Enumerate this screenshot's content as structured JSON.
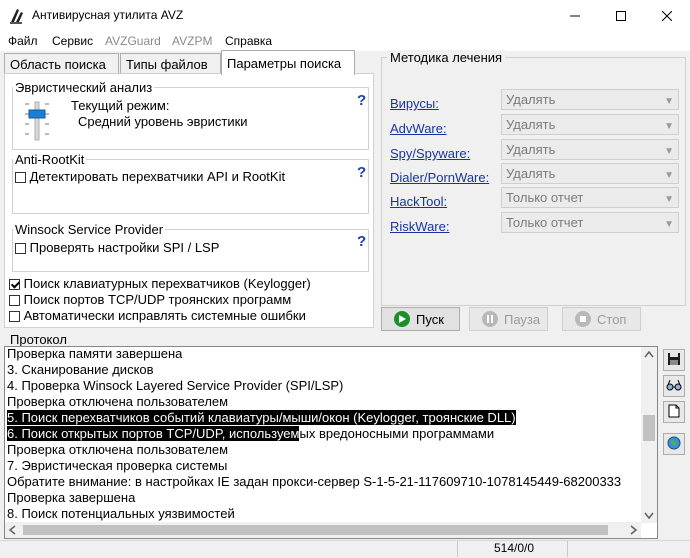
{
  "window": {
    "title": "Антивирусная утилита AVZ",
    "controls": [
      "minimize-icon",
      "maximize-icon",
      "close-icon"
    ]
  },
  "menu": {
    "items": [
      {
        "label": "Файл",
        "enabled": true
      },
      {
        "label": "Сервис",
        "enabled": true
      },
      {
        "label": "AVZGuard",
        "enabled": false
      },
      {
        "label": "AVZPM",
        "enabled": false
      },
      {
        "label": "Справка",
        "enabled": true
      }
    ]
  },
  "tabs": [
    {
      "label": "Область поиска",
      "active": false
    },
    {
      "label": "Типы файлов",
      "active": false
    },
    {
      "label": "Параметры поиска",
      "active": true
    }
  ],
  "search_params": {
    "heuristic": {
      "title": "Эвристический анализ",
      "mode_label": "Текущий режим:",
      "mode_value": "Средний уровень эвристики",
      "help": "?"
    },
    "antirootkit": {
      "title": "Anti-RootKit",
      "checkbox_label": "Детектировать перехватчики API и RootKit",
      "checked": false,
      "help": "?"
    },
    "winsock": {
      "title": "Winsock  Service Provider",
      "checkbox_label": "Проверять настройки SPI / LSP",
      "checked": false,
      "help": "?"
    },
    "options": [
      {
        "label": "Поиск клавиатурных перехватчиков (Keylogger)",
        "checked": true
      },
      {
        "label": "Поиск портов TCP/UDP троянских программ",
        "checked": false
      },
      {
        "label": "Автоматически исправлять системные ошибки",
        "checked": false
      }
    ]
  },
  "treatment": {
    "title": "Методика лечения",
    "rows": [
      {
        "label": "Вирусы:",
        "value": "Удалять"
      },
      {
        "label": "AdvWare:",
        "value": "Удалять"
      },
      {
        "label": "Spy/Spyware:",
        "value": "Удалять"
      },
      {
        "label": "Dialer/PornWare:",
        "value": "Удалять"
      },
      {
        "label": "HackTool:",
        "value": "Только отчет"
      },
      {
        "label": "RiskWare:",
        "value": "Только отчет"
      }
    ]
  },
  "actions": {
    "start": "Пуск",
    "pause": "Пауза",
    "stop": "Стоп"
  },
  "protocol": {
    "title": "Протокол",
    "lines": [
      {
        "text": "Проверка памяти завершена",
        "selected": false
      },
      {
        "text": "3. Сканирование дисков",
        "selected": false
      },
      {
        "text": "4. Проверка Winsock Layered Service Provider (SPI/LSP)",
        "selected": false
      },
      {
        "text": " Проверка отключена пользователем",
        "selected": false
      },
      {
        "text": "5. Поиск перехватчиков событий клавиатуры/мыши/окон (Keylogger, троянские DLL)",
        "selected": true
      },
      {
        "text": "6. Поиск открытых портов TCP/UDP, используем",
        "selected": true,
        "rest": "ых вредоносными программами"
      },
      {
        "text": " Проверка отключена пользователем",
        "selected": false
      },
      {
        "text": "7. Эвристичеcкая проверка системы",
        "selected": false
      },
      {
        "text": "Обратите внимание: в настройках IE задан прокси-сервер S-1-5-21-117609710-1078145449-68200333",
        "selected": false
      },
      {
        "text": "Проверка завершена",
        "selected": false
      },
      {
        "text": "8. Поиск потенциальных уязвимостей",
        "selected": false
      }
    ],
    "side_buttons": [
      "save-icon",
      "glasses-icon",
      "document-icon",
      "globe-icon"
    ]
  },
  "status": {
    "counter": "514/0/0"
  }
}
